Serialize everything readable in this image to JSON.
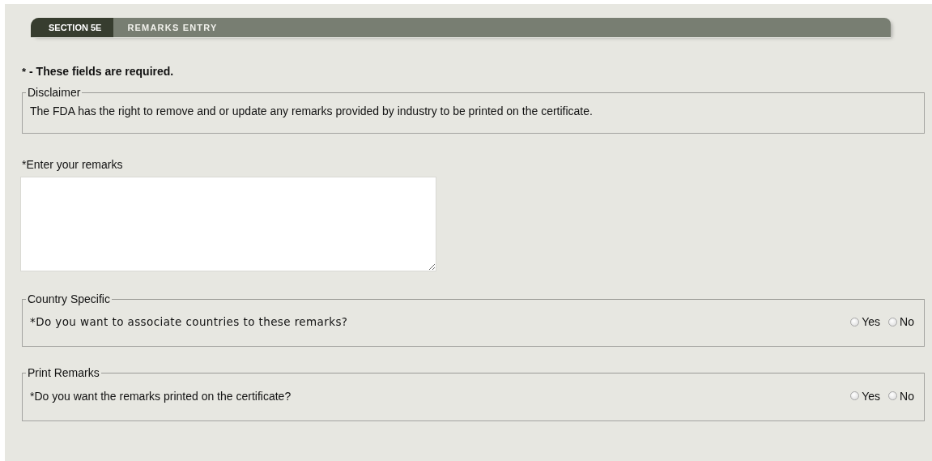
{
  "header": {
    "section": "SECTION 5E",
    "title": "REMARKS ENTRY"
  },
  "required_note": {
    "mark": "*",
    "text": "- These fields are required."
  },
  "disclaimer": {
    "legend": "Disclaimer",
    "text": "The FDA has the right to remove and or update any remarks provided by industry to be printed on the certificate."
  },
  "remarks": {
    "label": "*Enter your remarks"
  },
  "questions": [
    {
      "legend": "Country Specific",
      "question": "*Do you want to associate countries to these remarks?",
      "kind": "verdana",
      "options": [
        {
          "label": "Yes",
          "selected": false
        },
        {
          "label": "No",
          "selected": false
        }
      ]
    },
    {
      "legend": "Print Remarks",
      "question": "*Do you want the remarks printed on the certificate?",
      "kind": "plain",
      "options": [
        {
          "label": "Yes",
          "selected": false
        },
        {
          "label": "No",
          "selected": false
        }
      ]
    }
  ]
}
